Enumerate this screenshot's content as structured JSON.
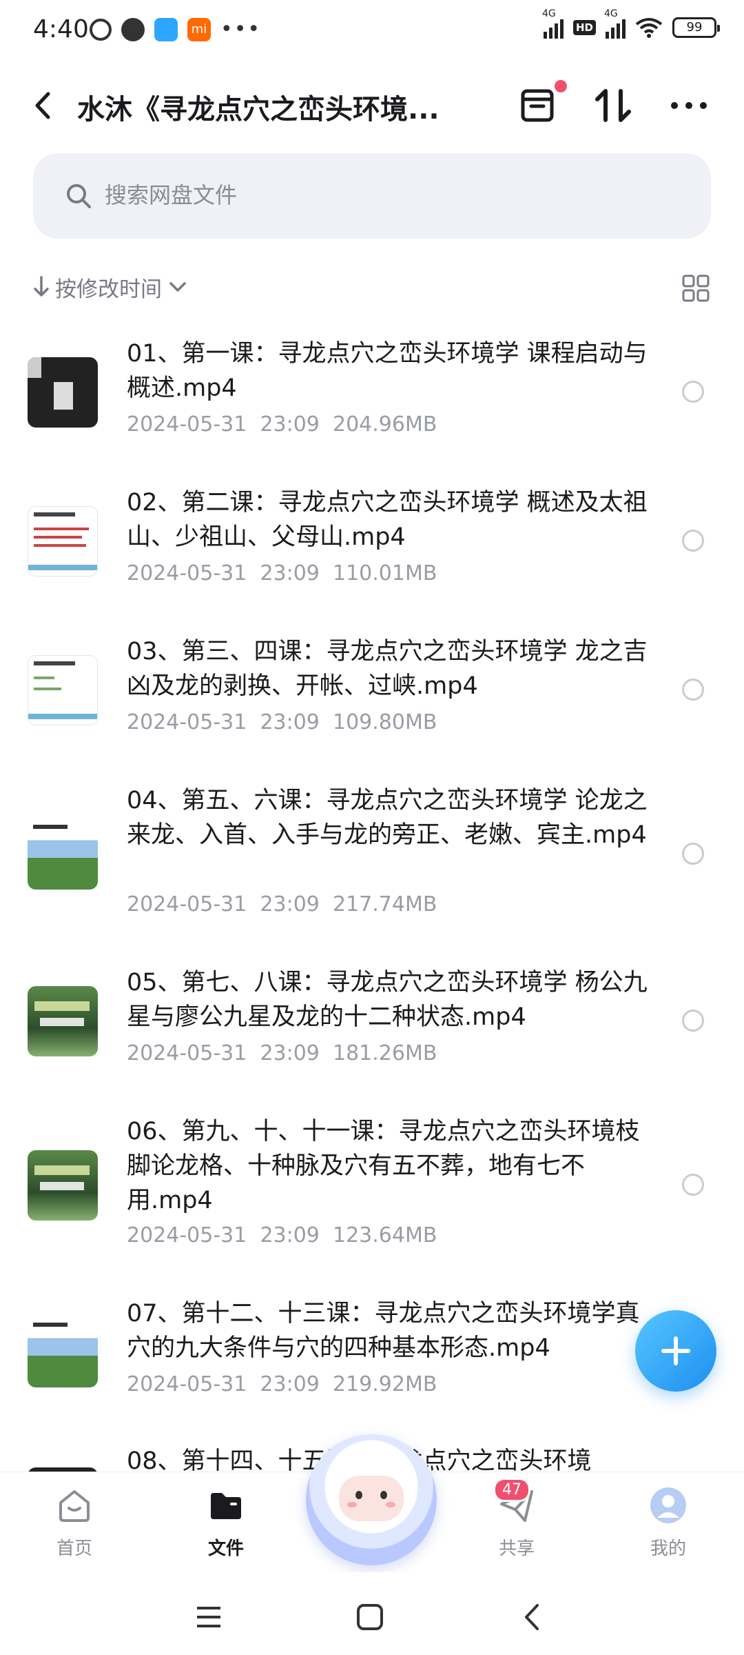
{
  "status_bar": {
    "time": "4:40",
    "battery": "99",
    "network_1": "4G",
    "network_2": "4G",
    "hd": "HD",
    "mi_label": "mi",
    "overflow": "•••"
  },
  "header": {
    "title": "水沐《寻龙点穴之峦头环境..."
  },
  "search": {
    "placeholder": "搜索网盘文件"
  },
  "sort": {
    "label": "按修改时间"
  },
  "files": [
    {
      "name": "01、第一课：寻龙点穴之峦头环境学 课程启动与概述.mp4",
      "date": "2024-05-31",
      "time": "23:09",
      "size": "204.96MB",
      "thumb": "video"
    },
    {
      "name": "02、第二课：寻龙点穴之峦头环境学 概述及太祖山、少祖山、父母山.mp4",
      "date": "2024-05-31",
      "time": "23:09",
      "size": "110.01MB",
      "thumb": "slide"
    },
    {
      "name": "03、第三、四课：寻龙点穴之峦头环境学 龙之吉凶及龙的剥换、开帐、过峡.mp4",
      "date": "2024-05-31",
      "time": "23:09",
      "size": "109.80MB",
      "thumb": "slide-map"
    },
    {
      "name": "04、第五、六课：寻龙点穴之峦头环境学 论龙之来龙、入首、入手与龙的旁正、老嫩、宾主.mp4",
      "date": "2024-05-31",
      "time": "23:09",
      "size": "217.74MB",
      "thumb": "landscape"
    },
    {
      "name": "05、第七、八课：寻龙点穴之峦头环境学 杨公九星与廖公九星及龙的十二种状态.mp4",
      "date": "2024-05-31",
      "time": "23:09",
      "size": "181.26MB",
      "thumb": "forest"
    },
    {
      "name": "06、第九、十、十一课：寻龙点穴之峦头环境枝脚论龙格、十种脉及穴有五不葬，地有七不用.mp4",
      "date": "2024-05-31",
      "time": "23:09",
      "size": "123.64MB",
      "thumb": "forest"
    },
    {
      "name": "07、第十二、十三课：寻龙点穴之峦头环境学真穴的九大条件与穴的四种基本形态.mp4",
      "date": "2024-05-31",
      "time": "23:09",
      "size": "219.92MB",
      "thumb": "landscape"
    },
    {
      "name": "08、第十四、十五课：寻龙点穴之峦头环境",
      "date": "",
      "time": "",
      "size": "",
      "thumb": "dark"
    }
  ],
  "tabs": [
    {
      "label": "首页",
      "icon": "home-icon"
    },
    {
      "label": "文件",
      "icon": "folder-icon"
    },
    {
      "label": "共享",
      "icon": "paper-plane-icon",
      "badge": "47"
    },
    {
      "label": "我的",
      "icon": "avatar-icon"
    }
  ],
  "colors": {
    "accent": "#1e8ef0",
    "badge": "#f04f6e",
    "search_bg": "#f0f1f7",
    "meta_text": "#9a9ca5"
  }
}
